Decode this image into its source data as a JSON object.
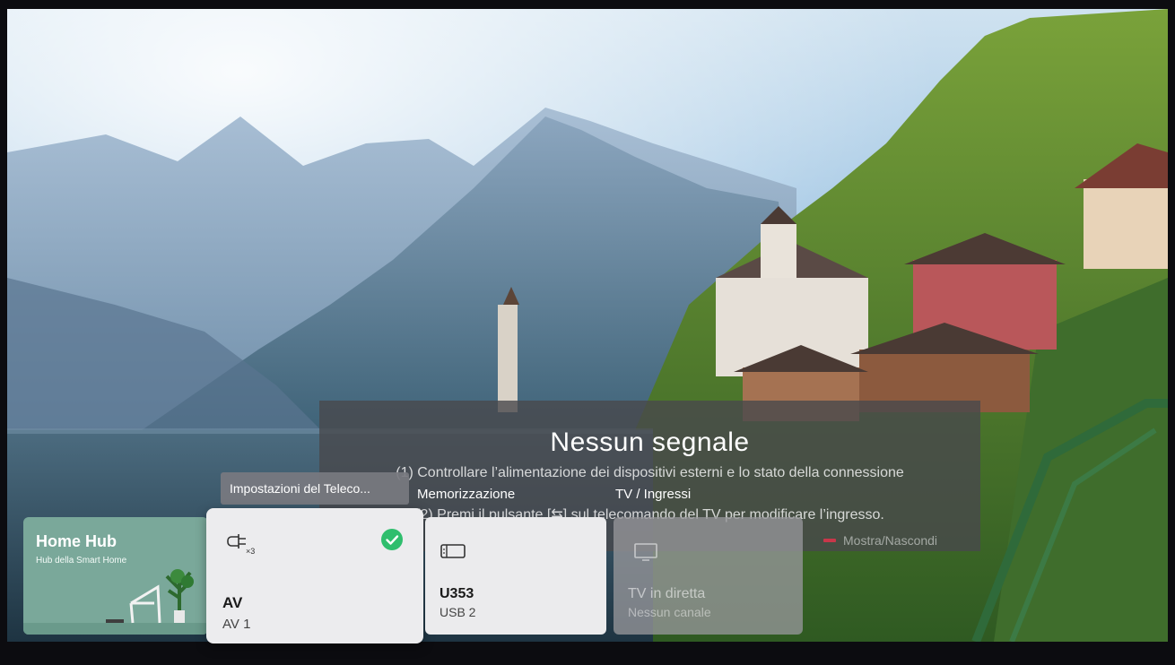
{
  "no_signal": {
    "title": "Nessun segnale",
    "line1": "(1) Controllare l’alimentazione dei dispositivi esterni e lo stato della connessione",
    "line2": "(2) Premi il pulsante [⇆] sul telecomando del TV per modificare l’ingresso.",
    "toggle_label": "Mostra/Nascondi"
  },
  "tooltip": "Impostazioni del Teleco...",
  "row_labels": {
    "storage": "Memorizzazione",
    "tv_inputs": "TV / Ingressi"
  },
  "home_hub": {
    "title": "Home Hub",
    "subtitle": "Hub della Smart Home"
  },
  "cards": [
    {
      "name": "AV",
      "sub": "AV 1",
      "icon": "av-input-icon",
      "icon_badge": "×3",
      "selected": true
    },
    {
      "name": "U353",
      "sub": "USB 2",
      "icon": "usb-storage-icon",
      "selected": false
    },
    {
      "name": "TV in diretta",
      "sub": "Nessun canale",
      "icon": "tv-monitor-icon",
      "selected": false,
      "disabled": true
    }
  ],
  "colors": {
    "selected_check": "#2fbe6d",
    "toggle_red": "#c8374a",
    "home_hub_card": "#7aa89a"
  }
}
